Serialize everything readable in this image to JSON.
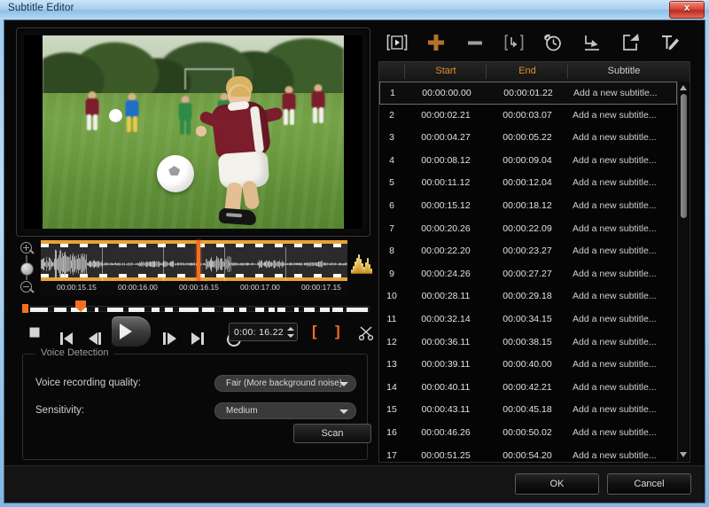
{
  "window": {
    "title": "Subtitle Editor",
    "close_label": "x"
  },
  "preview": {
    "description": "soccer-field-boy-kicking-ball"
  },
  "timeline": {
    "ruler_ticks": [
      "00:00:15.15",
      "00:00:16.00",
      "00:00:16.15",
      "00:00:17.00",
      "00:00:17.15"
    ],
    "zoom_in_icon": "zoom-in-icon",
    "zoom_out_icon": "zoom-out-icon",
    "audio_icon": "audio-waveform-icon"
  },
  "transport": {
    "stop": "stop-icon",
    "prev": "previous-icon",
    "step_back": "step-backward-icon",
    "play": "play-icon",
    "step_fwd": "step-forward-icon",
    "next": "next-icon",
    "loop": "loop-icon",
    "time_value": "0:00: 16.22",
    "mark_in": "[",
    "mark_out": "]",
    "cut": "scissors-icon"
  },
  "voice_detection": {
    "title": "Voice Detection",
    "quality_label": "Voice recording quality:",
    "quality_value": "Fair (More background noise)",
    "sensitivity_label": "Sensitivity:",
    "sensitivity_value": "Medium",
    "scan_label": "Scan"
  },
  "toolbar": {
    "items": [
      {
        "name": "play-selected-icon",
        "label": "[|>]"
      },
      {
        "name": "add-subtitle-icon",
        "label": "+"
      },
      {
        "name": "remove-subtitle-icon",
        "label": "-"
      },
      {
        "name": "split-subtitle-icon",
        "label": "[>]"
      },
      {
        "name": "timing-clock-icon",
        "label": "clock"
      },
      {
        "name": "import-subtitle-icon",
        "label": "import"
      },
      {
        "name": "export-subtitle-icon",
        "label": "export"
      },
      {
        "name": "edit-text-icon",
        "label": "edit"
      }
    ]
  },
  "table": {
    "headers": [
      "",
      "Start",
      "End",
      "Subtitle"
    ],
    "rows": [
      {
        "num": "1",
        "start": "00:00:00.00",
        "end": "00:00:01.22",
        "subtitle": "Add a new subtitle..."
      },
      {
        "num": "2",
        "start": "00:00:02.21",
        "end": "00:00:03.07",
        "subtitle": "Add a new subtitle..."
      },
      {
        "num": "3",
        "start": "00:00:04.27",
        "end": "00:00:05.22",
        "subtitle": "Add a new subtitle..."
      },
      {
        "num": "4",
        "start": "00:00:08.12",
        "end": "00:00:09.04",
        "subtitle": "Add a new subtitle..."
      },
      {
        "num": "5",
        "start": "00:00:11.12",
        "end": "00:00:12.04",
        "subtitle": "Add a new subtitle..."
      },
      {
        "num": "6",
        "start": "00:00:15.12",
        "end": "00:00:18.12",
        "subtitle": "Add a new subtitle..."
      },
      {
        "num": "7",
        "start": "00:00:20.26",
        "end": "00:00:22.09",
        "subtitle": "Add a new subtitle..."
      },
      {
        "num": "8",
        "start": "00:00:22.20",
        "end": "00:00:23.27",
        "subtitle": "Add a new subtitle..."
      },
      {
        "num": "9",
        "start": "00:00:24.26",
        "end": "00:00:27.27",
        "subtitle": "Add a new subtitle..."
      },
      {
        "num": "10",
        "start": "00:00:28.11",
        "end": "00:00:29.18",
        "subtitle": "Add a new subtitle..."
      },
      {
        "num": "11",
        "start": "00:00:32.14",
        "end": "00:00:34.15",
        "subtitle": "Add a new subtitle..."
      },
      {
        "num": "12",
        "start": "00:00:36.11",
        "end": "00:00:38.15",
        "subtitle": "Add a new subtitle..."
      },
      {
        "num": "13",
        "start": "00:00:39.11",
        "end": "00:00:40.00",
        "subtitle": "Add a new subtitle..."
      },
      {
        "num": "14",
        "start": "00:00:40.11",
        "end": "00:00:42.21",
        "subtitle": "Add a new subtitle..."
      },
      {
        "num": "15",
        "start": "00:00:43.11",
        "end": "00:00:45.18",
        "subtitle": "Add a new subtitle..."
      },
      {
        "num": "16",
        "start": "00:00:46.26",
        "end": "00:00:50.02",
        "subtitle": "Add a new subtitle..."
      },
      {
        "num": "17",
        "start": "00:00:51.25",
        "end": "00:00:54.20",
        "subtitle": "Add a new subtitle..."
      }
    ],
    "selected_row": 0
  },
  "footer": {
    "ok_label": "OK",
    "cancel_label": "Cancel"
  },
  "colors": {
    "accent_orange": "#f4701f",
    "header_orange": "#e08a2e",
    "titlebar_blue": "#a8d0ef"
  }
}
